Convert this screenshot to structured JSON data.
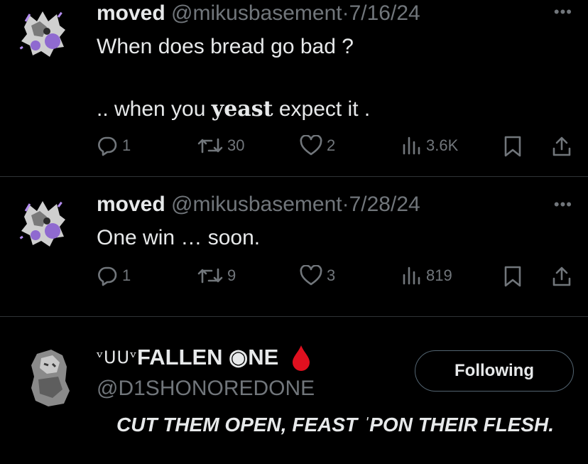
{
  "tweets": [
    {
      "name": "moved",
      "handle": "@mikusbasement",
      "sep": "·",
      "date": "7/16/24",
      "line1": "When does bread go bad ?",
      "line2_before": ".. when you ",
      "line2_bold": "yeast",
      "line2_after": " expect it .",
      "replies": "1",
      "reposts": "30",
      "likes": "2",
      "views": "3.6K"
    },
    {
      "name": "moved",
      "handle": "@mikusbasement",
      "sep": "·",
      "date": "7/28/24",
      "line1": "One win … soon.",
      "replies": "1",
      "reposts": "9",
      "likes": "3",
      "views": "819"
    }
  ],
  "profile": {
    "name_prefix": "ᵛᑌᑌᵛ",
    "name_main": "FALLEN ◉NE",
    "handle": "@D1SHONOREDONE",
    "bio_before": "CUT THEM OPEN, FEAST ",
    "bio_mark": "ˈ",
    "bio_after": "PON THEIR FLESH.",
    "follow_label": "Following"
  },
  "icons": {
    "more": "more-horizontal-icon",
    "reply": "reply-icon",
    "repost": "repost-icon",
    "like": "heart-icon",
    "views": "views-icon",
    "bookmark": "bookmark-icon",
    "share": "share-icon",
    "drop": "blood-drop-icon"
  },
  "colors": {
    "background": "#000000",
    "text": "#e7e9ea",
    "muted": "#71767b",
    "divider": "#2f3336",
    "drop": "#e0101f",
    "avatar_purple": "#8f6ad0"
  }
}
